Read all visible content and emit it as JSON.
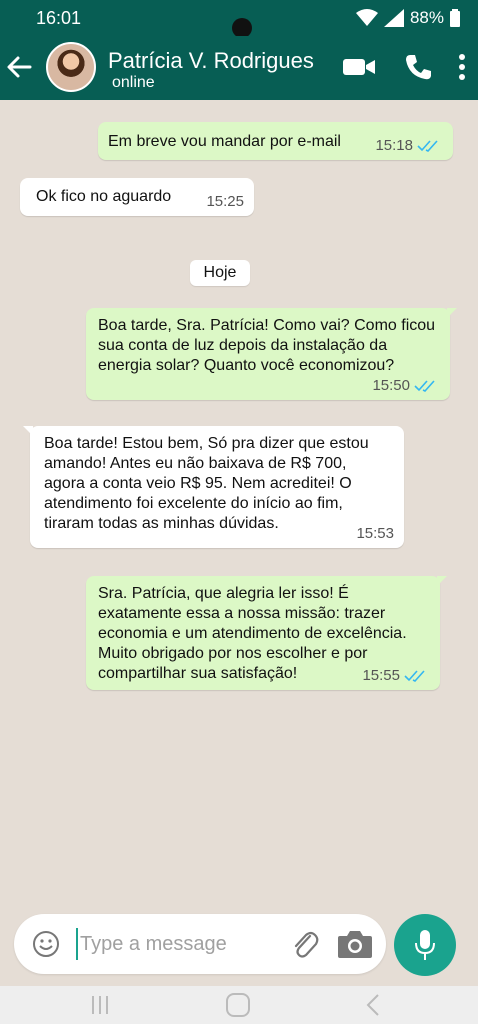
{
  "status_bar": {
    "time": "16:01",
    "battery": "88%"
  },
  "header": {
    "contact_name": "Patrícia V. Rodrigues",
    "contact_status": "online"
  },
  "messages": [
    {
      "direction": "out",
      "text": "Em breve vou mandar por e-mail",
      "time": "15:18",
      "read": true
    },
    {
      "direction": "in",
      "text": "Ok fico no aguardo",
      "time": "15:25"
    },
    {
      "direction": "out",
      "text": "Boa tarde, Sra. Patrícia! Como vai? Como ficou sua conta de luz depois da instalação da energia solar? Quanto você economizou?",
      "time": "15:50",
      "read": true
    },
    {
      "direction": "in",
      "text": "Boa tarde! Estou bem, Só pra dizer que estou amando! Antes eu não baixava de R$ 700, agora a conta veio R$ 95. Nem acreditei! O atendimento foi excelente do início ao fim, tiraram todas as minhas dúvidas.",
      "time": "15:53"
    },
    {
      "direction": "out",
      "text": "Sra. Patrícia, que alegria ler isso! É exatamente essa a nossa missão: trazer economia e um atendimento de excelência. Muito obrigado por nos escolher e por compartilhar sua satisfação!",
      "time": "15:55",
      "read": true
    }
  ],
  "date_divider": "Hoje",
  "composer": {
    "placeholder": "Type a message"
  },
  "colors": {
    "header": "#075e54",
    "outgoing_bubble": "#dcf8c6",
    "incoming_bubble": "#ffffff",
    "accent": "#1aa38e",
    "chat_bg": "#e5ddd5",
    "read_tick": "#34b7f1"
  },
  "icons": [
    "back-arrow-icon",
    "video-call-icon",
    "phone-icon",
    "more-vert-icon",
    "emoji-icon",
    "attach-icon",
    "camera-icon",
    "mic-icon",
    "read-ticks-icon",
    "signal-icon",
    "wifi-icon",
    "battery-icon"
  ]
}
